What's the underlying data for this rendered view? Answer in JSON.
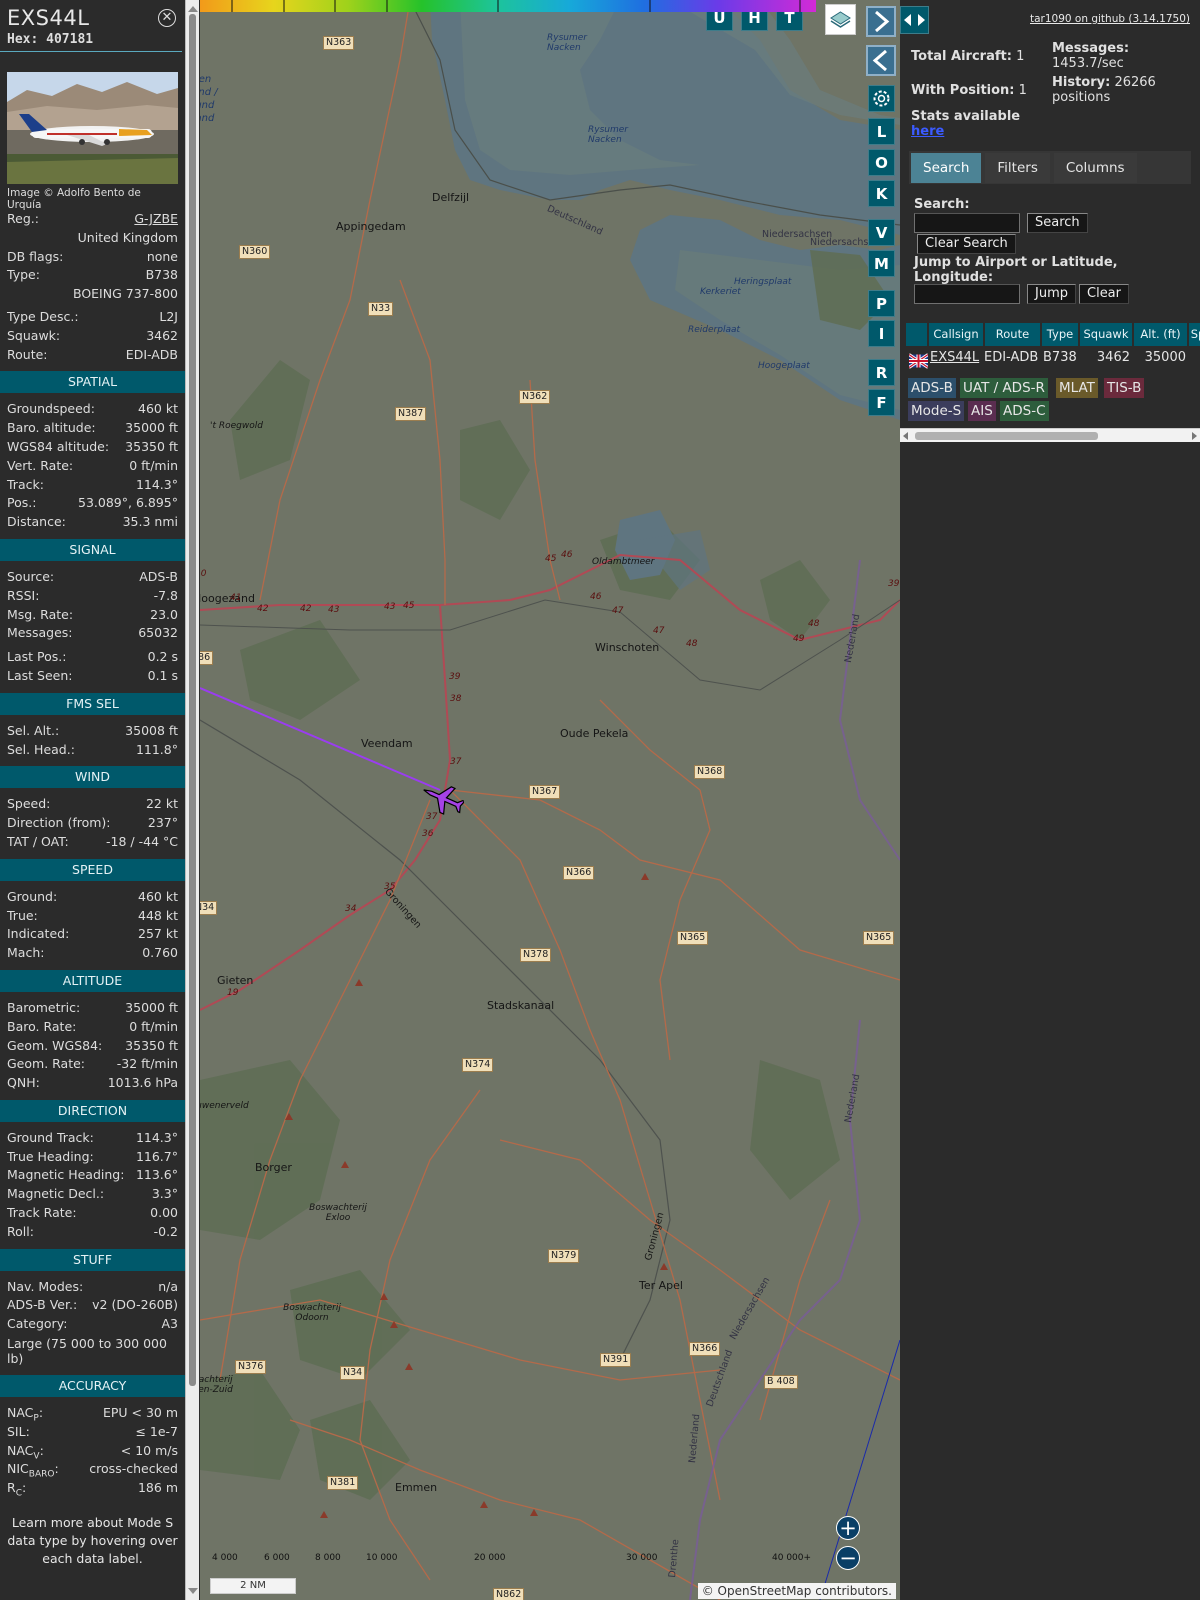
{
  "info": {
    "callsign": "EXS44L",
    "hex_label": "Hex:",
    "hex": "407181",
    "photo_credit": "Image © Adolfo Bento de Urquía",
    "basic": [
      {
        "label": "Reg.:",
        "value": "G-JZBE",
        "link": true
      },
      {
        "label": "",
        "value": "United Kingdom"
      },
      {
        "label": "DB flags:",
        "value": "none"
      },
      {
        "label": "Type:",
        "value": "B738"
      },
      {
        "label": "",
        "value": "BOEING 737-800"
      },
      {
        "label": "Type Desc.:",
        "value": "L2J"
      },
      {
        "label": "Squawk:",
        "value": "3462"
      },
      {
        "label": "Route:",
        "value": "EDI-ADB"
      }
    ],
    "sections": [
      {
        "title": "SPATIAL",
        "rows": [
          {
            "label": "Groundspeed:",
            "value": "460 kt"
          },
          {
            "label": "Baro. altitude:",
            "value": "35000 ft"
          },
          {
            "label": "WGS84 altitude:",
            "value": "35350 ft"
          },
          {
            "label": "Vert. Rate:",
            "value": "0 ft/min"
          },
          {
            "label": "Track:",
            "value": "114.3°"
          },
          {
            "label": "Pos.:",
            "value": "53.089°, 6.895°"
          },
          {
            "label": "Distance:",
            "value": "35.3 nmi"
          }
        ]
      },
      {
        "title": "SIGNAL",
        "rows": [
          {
            "label": "Source:",
            "value": "ADS-B"
          },
          {
            "label": "RSSI:",
            "value": "-7.8"
          },
          {
            "label": "Msg. Rate:",
            "value": "23.0"
          },
          {
            "label": "Messages:",
            "value": "65032"
          },
          {
            "label": "",
            "value": "",
            "gap": true
          },
          {
            "label": "Last Pos.:",
            "value": "0.2 s"
          },
          {
            "label": "Last Seen:",
            "value": "0.1 s"
          }
        ]
      },
      {
        "title": "FMS SEL",
        "rows": [
          {
            "label": "Sel. Alt.:",
            "value": "35008 ft"
          },
          {
            "label": "Sel. Head.:",
            "value": "111.8°"
          }
        ]
      },
      {
        "title": "WIND",
        "rows": [
          {
            "label": "Speed:",
            "value": "22 kt"
          },
          {
            "label": "Direction (from):",
            "value": "237°"
          },
          {
            "label": "TAT / OAT:",
            "value": "-18 / -44 °C"
          }
        ]
      },
      {
        "title": "SPEED",
        "rows": [
          {
            "label": "Ground:",
            "value": "460 kt"
          },
          {
            "label": "True:",
            "value": "448 kt"
          },
          {
            "label": "Indicated:",
            "value": "257 kt"
          },
          {
            "label": "Mach:",
            "value": "0.760"
          }
        ]
      },
      {
        "title": "ALTITUDE",
        "rows": [
          {
            "label": "Barometric:",
            "value": "35000 ft"
          },
          {
            "label": "Baro. Rate:",
            "value": "0 ft/min"
          },
          {
            "label": "Geom. WGS84:",
            "value": "35350 ft"
          },
          {
            "label": "Geom. Rate:",
            "value": "-32 ft/min"
          },
          {
            "label": "QNH:",
            "value": "1013.6 hPa"
          }
        ]
      },
      {
        "title": "DIRECTION",
        "rows": [
          {
            "label": "Ground Track:",
            "value": "114.3°"
          },
          {
            "label": "True Heading:",
            "value": "116.7°"
          },
          {
            "label": "Magnetic Heading:",
            "value": "113.6°"
          },
          {
            "label": "Magnetic Decl.:",
            "value": "3.3°"
          },
          {
            "label": "Track Rate:",
            "value": "0.00"
          },
          {
            "label": "Roll:",
            "value": "-0.2"
          }
        ]
      },
      {
        "title": "STUFF",
        "rows": [
          {
            "label": "Nav. Modes:",
            "value": "n/a"
          },
          {
            "label": "ADS-B Ver.:",
            "value": "v2 (DO-260B)"
          },
          {
            "label": "Category:",
            "value": "A3"
          },
          {
            "label": "Large (75 000 to 300 000 lb)",
            "value": "",
            "wrap": true
          }
        ]
      },
      {
        "title": "ACCURACY",
        "rows": [
          {
            "label": "NAC",
            "sub": "P",
            "after": ":",
            "value": "EPU < 30 m"
          },
          {
            "label": "SIL:",
            "value": "≤ 1e-7"
          },
          {
            "label": "NAC",
            "sub": "V",
            "after": ":",
            "value": "< 10 m/s"
          },
          {
            "label": "NIC",
            "sub": "BARO",
            "after": ":",
            "value": "cross-checked"
          },
          {
            "label": "R",
            "sub": "C",
            "after": ":",
            "value": "186 m"
          }
        ]
      }
    ],
    "footer": "Learn more about Mode S data type by hovering over each data label."
  },
  "map": {
    "towns": [
      {
        "name": "Appingedam"
      },
      {
        "name": "Delfzijl"
      },
      {
        "name": "Hoogezand"
      },
      {
        "name": "Winschoten"
      },
      {
        "name": "Veendam"
      },
      {
        "name": "Oude Pekela"
      },
      {
        "name": "Gieten"
      },
      {
        "name": "Stadskanaal"
      },
      {
        "name": "Borger"
      },
      {
        "name": "Ter Apel"
      },
      {
        "name": "Emmen"
      },
      {
        "name": "Oldambtmeer"
      },
      {
        "name": "Hond-en Paapzand / Hund und Paapsand"
      },
      {
        "name": "Rysumer Nacken"
      },
      {
        "name": "Rysumer Nacken"
      },
      {
        "name": "Heringsplaat"
      },
      {
        "name": "Kerkeriet"
      },
      {
        "name": "Reiderplaat"
      },
      {
        "name": "Hoogeplaat"
      },
      {
        "name": "'t Roegwold"
      },
      {
        "name": "Drouwenerveld"
      },
      {
        "name": "Boswachterij Exloo"
      },
      {
        "name": "Boswachterij Odoorn"
      },
      {
        "name": "Boswachterij Emmen-Zuid"
      },
      {
        "name": "Groningen"
      },
      {
        "name": "Groningen"
      },
      {
        "name": "Deutschland"
      },
      {
        "name": "Niedersachsen"
      },
      {
        "name": "Nederland"
      },
      {
        "name": "Niedersachsen"
      },
      {
        "name": "Nederland"
      },
      {
        "name": "Niedersachsen"
      },
      {
        "name": "Deutschland"
      },
      {
        "name": "Nederland"
      },
      {
        "name": "Drenthe"
      }
    ],
    "roads": [
      "N363",
      "N360",
      "N33",
      "N387",
      "N362",
      "N365",
      "N367",
      "N368",
      "N366",
      "N34",
      "N378",
      "N365",
      "N374",
      "N379",
      "N391",
      "N366",
      "B 408",
      "N376",
      "N34",
      "N381",
      "N862",
      "386"
    ],
    "km_marks": [
      "40",
      "41",
      "42",
      "42",
      "43",
      "43",
      "45",
      "45",
      "46",
      "46",
      "47",
      "47",
      "48",
      "48",
      "49",
      "39",
      "39",
      "38",
      "37",
      "37",
      "36",
      "35",
      "34",
      "19"
    ],
    "controls": {
      "top": [
        "U",
        "H",
        "T"
      ],
      "side": [
        "L",
        "O",
        "K",
        "V",
        "M",
        "P",
        "I",
        "R",
        "F"
      ]
    },
    "colorbar_ticks": [
      "4 000",
      "6 000",
      "8 000",
      "10 000",
      "20 000",
      "30 000",
      "40 000+"
    ],
    "scale": "2 NM",
    "attribution": "© OpenStreetMap contributors."
  },
  "panel": {
    "github": "tar1090 on github (3.14.1750)",
    "total_label": "Total Aircraft:",
    "total": "1",
    "pos_label": "With Position:",
    "pos": "1",
    "messages_label": "Messages:",
    "messages": "1453.7/sec",
    "history_label": "History:",
    "history": "26266 positions",
    "stats_label": "Stats available",
    "stats_link": "here",
    "tabs": [
      "Search",
      "Filters",
      "Columns"
    ],
    "search_label": "Search:",
    "search_btn": "Search",
    "clear_search_btn": "Clear Search",
    "jump_label": "Jump to Airport or Latitude, Longitude:",
    "jump_btn": "Jump",
    "clear_btn": "Clear",
    "columns": [
      "Callsign",
      "Route",
      "Type",
      "Squawk",
      "Alt. (ft)",
      "Sp"
    ],
    "rows": [
      {
        "callsign": "EXS44L",
        "route": "EDI-ADB",
        "type": "B738",
        "squawk": "3462",
        "alt": "35000"
      }
    ],
    "legend": [
      {
        "label": "ADS-B",
        "color": "#2c4f6b"
      },
      {
        "label": "UAT / ADS-R",
        "color": "#2d5d3c"
      },
      {
        "label": "MLAT",
        "color": "#6a5a2a"
      },
      {
        "label": "TIS-B",
        "color": "#6b2a3c"
      },
      {
        "label": "Mode-S",
        "color": "#3b3d5c"
      },
      {
        "label": "AIS",
        "color": "#5a2d50"
      },
      {
        "label": "ADS-C",
        "color": "#2d5d3c"
      }
    ]
  }
}
